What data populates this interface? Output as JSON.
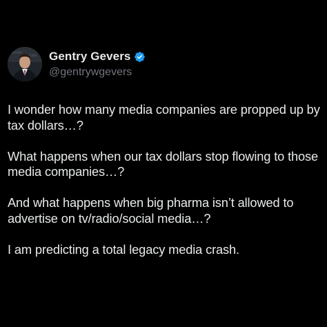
{
  "post": {
    "author": {
      "display_name": "Gentry Gevers",
      "handle": "@gentrywgevers",
      "verified": true,
      "verified_color": "#1d9bf0",
      "avatar_icon": "profile-photo"
    },
    "paragraphs": [
      "I wonder how many media companies are propped up by tax dollars…?",
      "What happens when our tax dollars stop flowing to those media companies…?",
      "And what happens when big pharma isn’t allowed to advertise on tv/radio/social media…?",
      "I am predicting a total legacy media crash."
    ]
  },
  "colors": {
    "background": "#000000",
    "text_primary": "#e7e9ea",
    "text_secondary": "#71767b"
  }
}
